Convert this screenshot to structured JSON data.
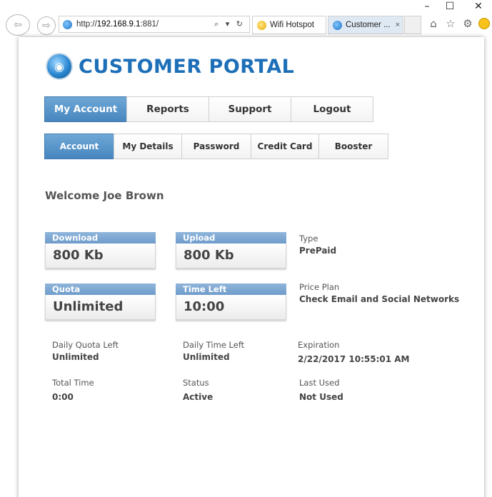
{
  "browser": {
    "url_prefix": "http://",
    "url_host": "192.168.9.1",
    "url_suffix": ":881/",
    "addr_controls": "⌕ ▾ ↻",
    "tabs": [
      {
        "label": "Wifi Hotspot"
      },
      {
        "label": "Customer ...",
        "close": "×"
      }
    ]
  },
  "portal": {
    "logo_text": "CUSTOMER PORTAL",
    "main_tabs": [
      "My Account",
      "Reports",
      "Support",
      "Logout"
    ],
    "sub_tabs": [
      "Account",
      "My Details",
      "Password",
      "Credit Card",
      "Booster"
    ],
    "welcome": "Welcome Joe Brown",
    "stats": {
      "download": {
        "label": "Download",
        "value": "800 Kb"
      },
      "upload": {
        "label": "Upload",
        "value": "800 Kb"
      },
      "quota": {
        "label": "Quota",
        "value": "Unlimited"
      },
      "time_left": {
        "label": "Time Left",
        "value": "10:00"
      }
    },
    "details": {
      "type": {
        "label": "Type",
        "value": "PrePaid"
      },
      "price_plan": {
        "label": "Price Plan",
        "value": "Check Email and Social Networks"
      },
      "daily_quota_left": {
        "label": "Daily Quota Left",
        "value": "Unlimited"
      },
      "daily_time_left": {
        "label": "Daily Time Left",
        "value": "Unlimited"
      },
      "expiration": {
        "label": "Expiration",
        "value": "2/22/2017 10:55:01 AM"
      },
      "total_time": {
        "label": "Total Time",
        "value": "0:00"
      },
      "status": {
        "label": "Status",
        "value": "Active"
      },
      "last_used": {
        "label": "Last Used",
        "value": "Not Used"
      }
    }
  },
  "colors": {
    "accent": "#4786bf",
    "logo": "#1d6fb8",
    "stat_header": "#7fa8d3"
  }
}
